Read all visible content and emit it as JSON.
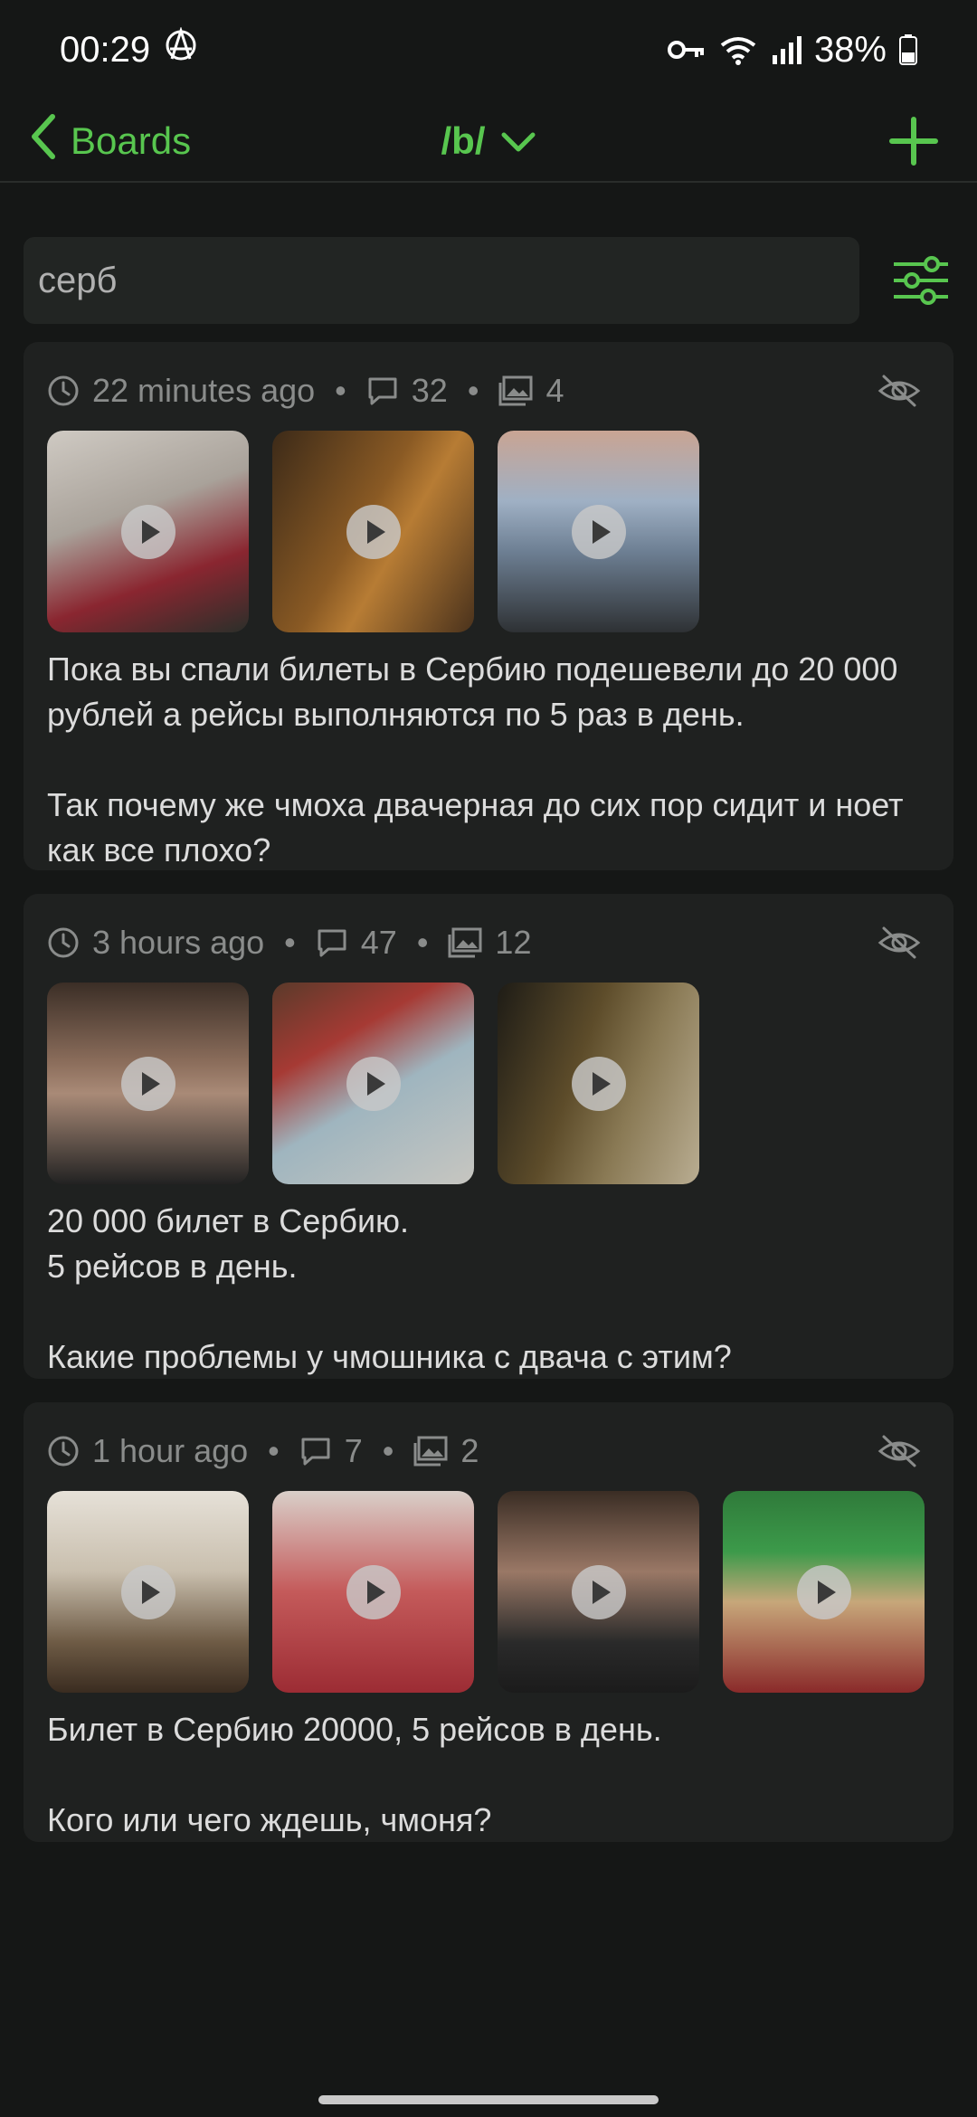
{
  "status_bar": {
    "time": "00:29",
    "battery": "38%",
    "icons": [
      "anarchy-icon",
      "key-icon",
      "wifi-icon",
      "signal-icon",
      "battery-icon"
    ]
  },
  "top_bar": {
    "back_label": "Boards",
    "board_name": "/b/",
    "accent": "#58c64f"
  },
  "search": {
    "value": "серб"
  },
  "threads": [
    {
      "time": "22 minutes ago",
      "replies": "32",
      "images": "4",
      "text": "Пока вы спали билеты в Сербию подешевели до 20 000 рублей а рейсы выполняются по 5 раз в день.\n\nТак почему же чмоха двачерная до сих пор сидит и ноет как все плохо?",
      "thumbs": [
        {
          "name": "thumb-baby-video",
          "bg": "linear-gradient(160deg,#cfcac3 0%,#a9a29a 40%,#8a2630 70%,#2b2f2a 100%)"
        },
        {
          "name": "thumb-door-video",
          "bg": "linear-gradient(120deg,#3c2a18 0%,#8a5a24 45%,#b77c34 60%,#4a321c 100%)"
        },
        {
          "name": "thumb-fire-video",
          "bg": "linear-gradient(180deg,#c9a493 0%,#9fb0c4 35%,#6d7f93 60%,#2e3134 100%)"
        }
      ]
    },
    {
      "time": "3 hours ago",
      "replies": "47",
      "images": "12",
      "text": "20 000 билет в Сербию.\n5 рейсов в день.\n\nКакие проблемы у чмошника с двача с этим?",
      "thumbs": [
        {
          "name": "thumb-man-video",
          "bg": "linear-gradient(180deg,#3b2e26 0%,#8c6e5c 40%,#a98a77 55%,#222222 100%)"
        },
        {
          "name": "thumb-hallway-video",
          "bg": "linear-gradient(150deg,#5a3a2a 0%,#a63a34 30%,#9fb5bf 55%,#c7c6c0 100%)"
        },
        {
          "name": "thumb-corridor-video",
          "bg": "linear-gradient(110deg,#1e1c16 0%,#5d4c2a 40%,#8a7a55 65%,#b9ad92 100%)"
        }
      ]
    },
    {
      "time": "1 hour ago",
      "replies": "7",
      "images": "2",
      "text": "Билет в Сербию 20000, 5 рейсов в день.\n\nКого или чего ждешь, чмоня?",
      "thumbs": [
        {
          "name": "thumb-kitchen-video",
          "bg": "linear-gradient(180deg,#e6e1d8 0%,#c9bfae 40%,#6e5b45 75%,#3a2c20 100%)"
        },
        {
          "name": "thumb-girl-video",
          "bg": "linear-gradient(180deg,#d9cfc9 0%,#c45a5a 50%,#9c2c34 100%)"
        },
        {
          "name": "thumb-man2-video",
          "bg": "linear-gradient(180deg,#3a2d24 0%,#9a7866 40%,#2a2a2a 75%,#1b1b1b 100%)"
        },
        {
          "name": "thumb-greenhat-video",
          "bg": "linear-gradient(180deg,#2f7a3a 0%,#3c9a4a 30%,#c7a77a 55%,#8a2a2a 100%)"
        }
      ]
    }
  ]
}
